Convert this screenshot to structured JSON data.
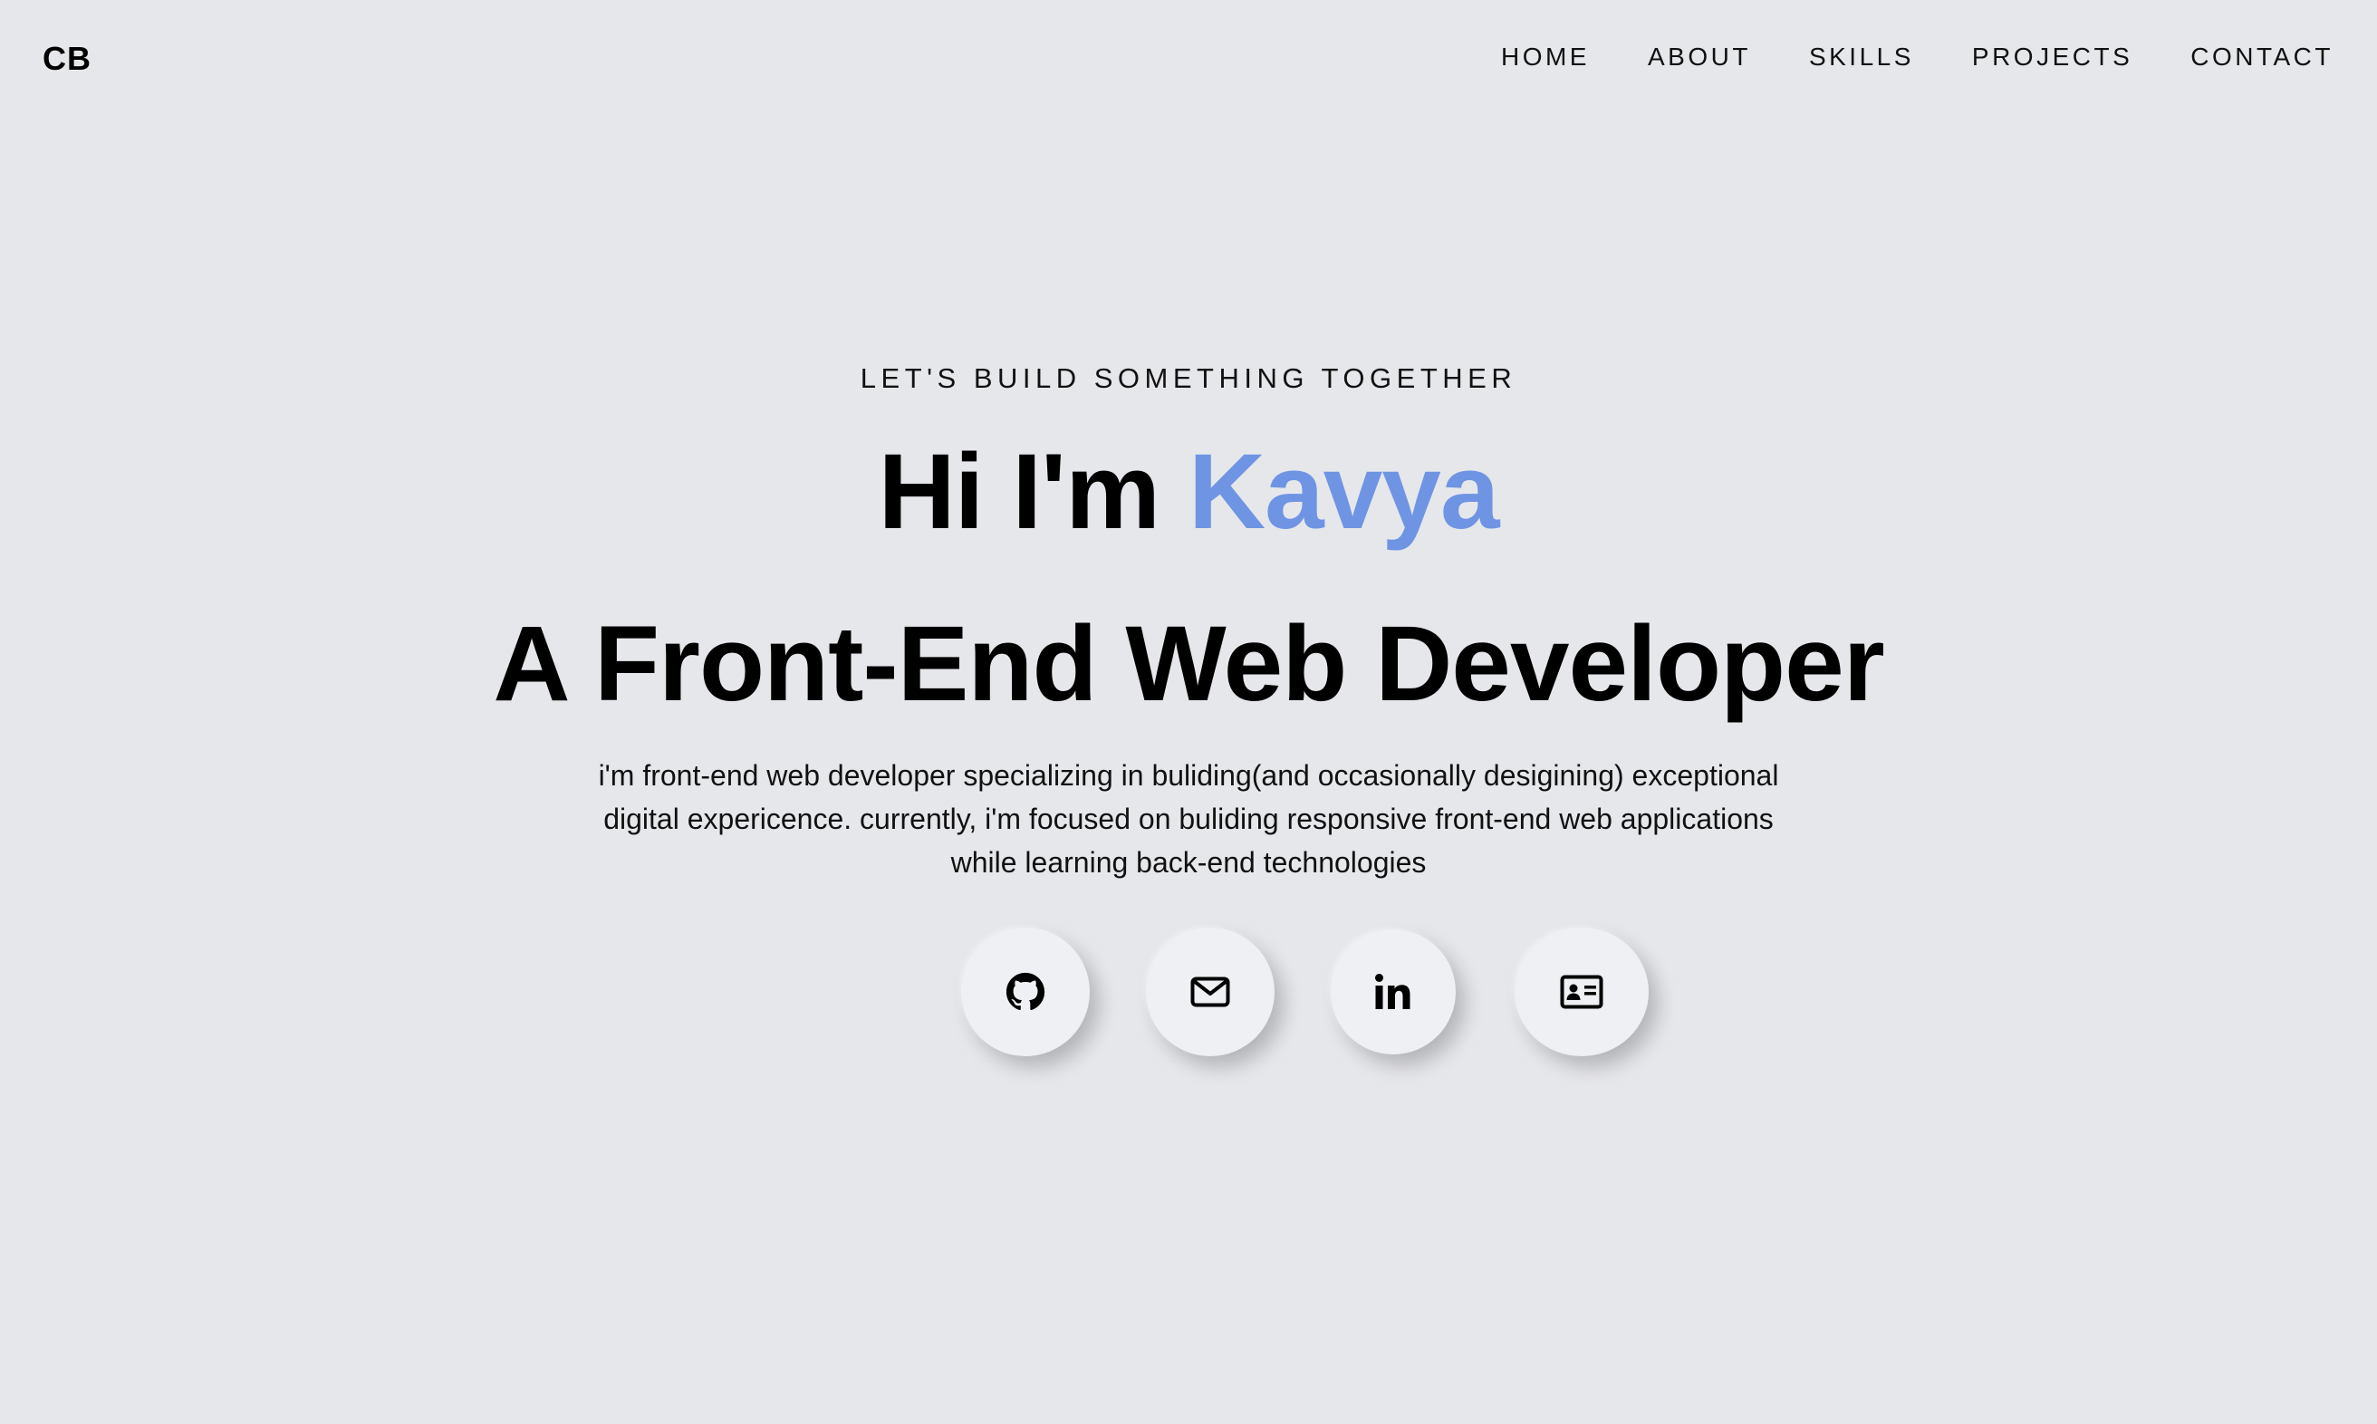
{
  "header": {
    "logo": "CB",
    "nav": [
      {
        "label": "HOME"
      },
      {
        "label": "ABOUT"
      },
      {
        "label": "SKILLS"
      },
      {
        "label": "PROJECTS"
      },
      {
        "label": "CONTACT"
      }
    ]
  },
  "hero": {
    "kicker": "LET'S BUILD SOMETHING TOGETHER",
    "greeting": "Hi I'm",
    "name": "Kavya",
    "role": "A Front-End Web Developer",
    "intro": "i'm front-end web developer specializing in buliding(and occasionally desigining) exceptional digital expericence. currently, i'm focused on buliding responsive front-end web applications while learning back-end technologies"
  },
  "socials": [
    {
      "icon": "github-icon"
    },
    {
      "icon": "envelope-icon"
    },
    {
      "icon": "linkedin-icon"
    },
    {
      "icon": "id-card-icon"
    }
  ],
  "colors": {
    "background": "#e6e7eb",
    "accent": "#6f94e3",
    "button_bg": "#eef0f3",
    "text": "#000000"
  }
}
